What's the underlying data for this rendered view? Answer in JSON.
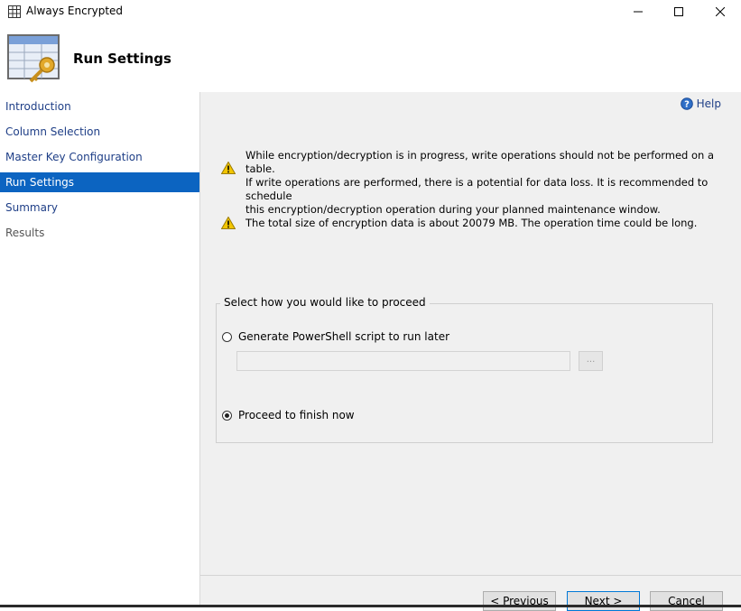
{
  "window": {
    "title": "Always Encrypted",
    "controls": [
      "minimize-icon",
      "maximize-icon",
      "close-icon"
    ]
  },
  "header": {
    "title": "Run Settings",
    "icon": "table-key-icon"
  },
  "sidebar": {
    "items": [
      {
        "label": "Introduction",
        "state": "link"
      },
      {
        "label": "Column Selection",
        "state": "link"
      },
      {
        "label": "Master Key Configuration",
        "state": "link"
      },
      {
        "label": "Run Settings",
        "state": "active"
      },
      {
        "label": "Summary",
        "state": "link"
      },
      {
        "label": "Results",
        "state": "disabled"
      }
    ]
  },
  "main": {
    "help_label": "Help",
    "warnings": [
      {
        "lines": [
          "While encryption/decryption is in progress, write operations should not be performed on a table.",
          "If write operations are performed, there is a potential for data loss. It is recommended to schedule",
          "this encryption/decryption operation during your planned maintenance window."
        ]
      },
      {
        "lines": [
          "The total size of encryption data is about 20079 MB. The operation time could be long."
        ]
      }
    ],
    "proceed_group": {
      "label": "Select how you would like to proceed",
      "options": [
        {
          "label": "Generate PowerShell script to run later",
          "selected": false
        },
        {
          "label": "Proceed to finish now",
          "selected": true
        }
      ],
      "script_path_value": "",
      "browse_label": "..."
    }
  },
  "footer": {
    "previous_label": "< Previous",
    "next_label": "Next >",
    "cancel_label": "Cancel"
  },
  "colors": {
    "accent": "#0c64c1",
    "link": "#1f3f87",
    "panel_bg": "#f0f0f0",
    "warning": "#f2c500"
  }
}
